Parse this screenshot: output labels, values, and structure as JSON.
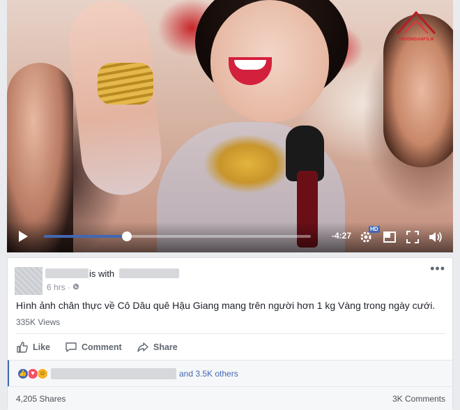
{
  "video": {
    "watermark_text": "TRUONGANFILM",
    "time_remaining": "-4:27",
    "progress_fraction": 0.31,
    "hd_label": "HD"
  },
  "post": {
    "is_with": "is with",
    "timestamp": "6 hrs",
    "separator": "·",
    "text": "Hình ảnh chân thực về Cô Dâu quê Hậu Giang mang trên người hơn 1 kg Vàng trong ngày cưới.",
    "views": "335K Views",
    "more_label": "•••"
  },
  "actions": {
    "like": "Like",
    "comment": "Comment",
    "share": "Share"
  },
  "reactions": {
    "others_text": "and 3.5K others",
    "icons": [
      "like-reaction",
      "love-reaction",
      "haha-reaction"
    ]
  },
  "footer": {
    "shares": "4,205 Shares",
    "comments": "3K Comments"
  },
  "colors": {
    "accent": "#4267b2",
    "love": "#f25268",
    "haha": "#f7b125"
  }
}
